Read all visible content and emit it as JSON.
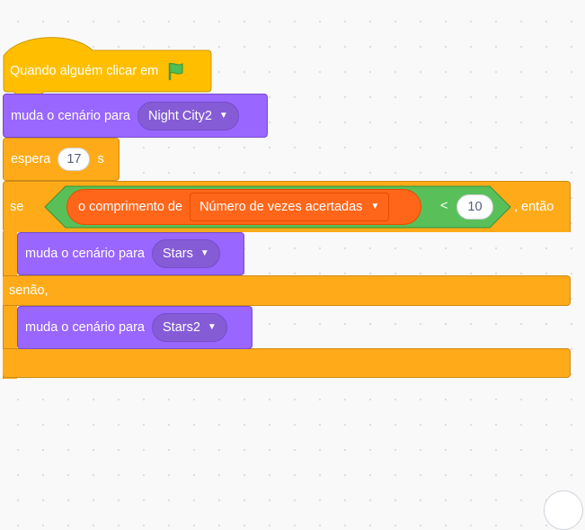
{
  "hat_block": {
    "text": "Quando alguém clicar em",
    "icon": "green-flag-icon"
  },
  "switch_backdrop_1": {
    "text": "muda o cenário para",
    "value": "Night City2"
  },
  "wait_block": {
    "text": "espera",
    "value": "17",
    "unit": "s"
  },
  "if_else": {
    "if_label": "se",
    "then_label": ", então",
    "else_label": "senão,",
    "condition": {
      "operator": "<",
      "reporter_text": "o comprimento de",
      "list_name": "Número de vezes acertadas",
      "compare_value": "10"
    },
    "then_block": {
      "text": "muda o cenário para",
      "value": "Stars"
    },
    "else_block": {
      "text": "muda o cenário para",
      "value": "Stars2"
    }
  },
  "colors": {
    "events": "#FFBF00",
    "looks": "#9966FF",
    "control": "#FFAB19",
    "operators": "#59C059",
    "data_list": "#FF661A"
  }
}
